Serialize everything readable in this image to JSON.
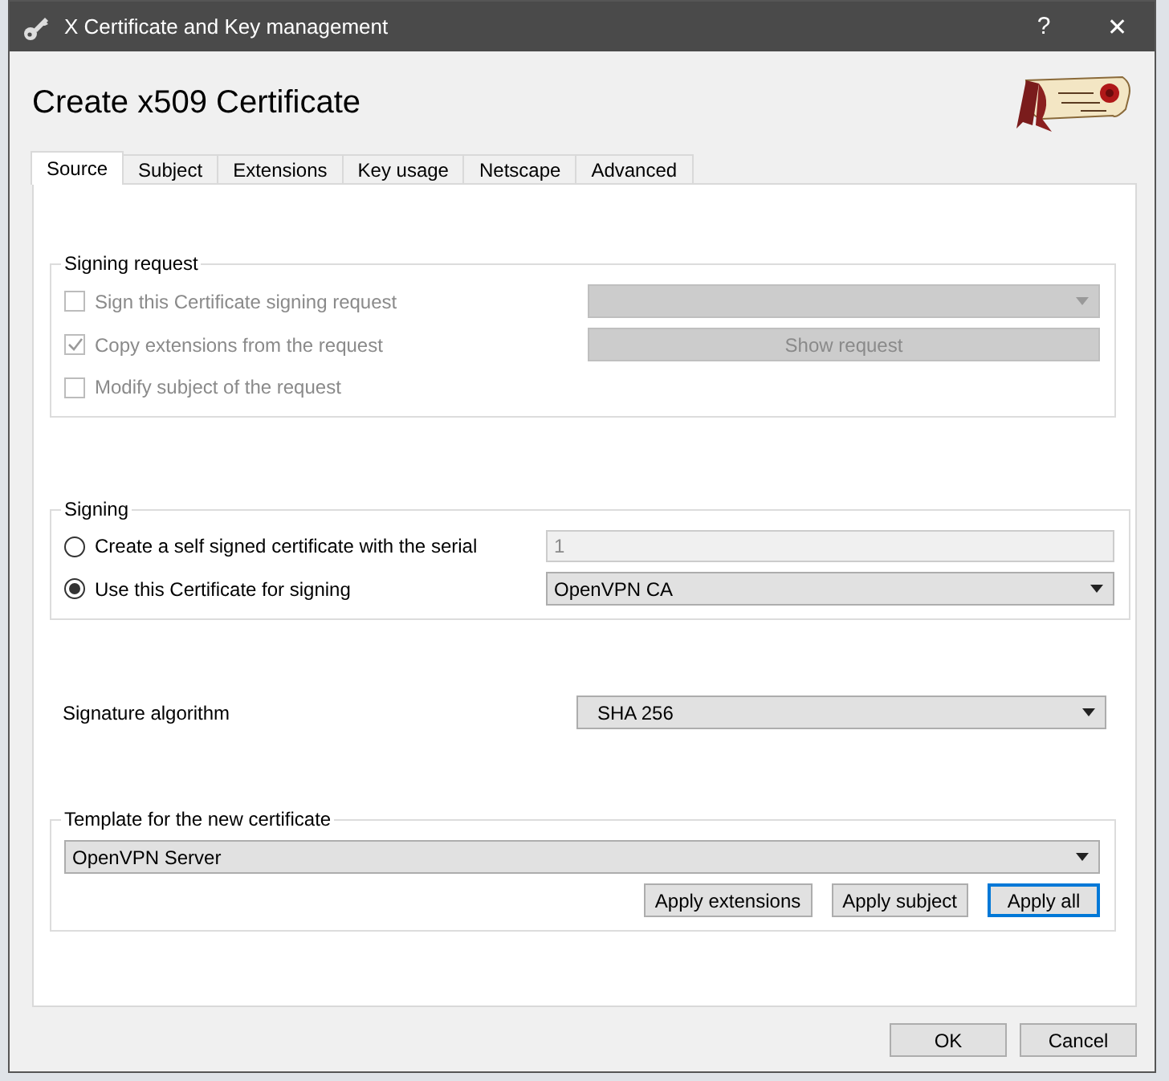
{
  "window": {
    "title": "X Certificate and Key management",
    "help": "?",
    "close": "✕"
  },
  "heading": "Create x509 Certificate",
  "tabs": [
    {
      "label": "Source",
      "selected": true
    },
    {
      "label": "Subject",
      "selected": false
    },
    {
      "label": "Extensions",
      "selected": false
    },
    {
      "label": "Key usage",
      "selected": false
    },
    {
      "label": "Netscape",
      "selected": false
    },
    {
      "label": "Advanced",
      "selected": false
    }
  ],
  "signing_request": {
    "title": "Signing request",
    "rows": [
      {
        "label": "Sign this Certificate signing request",
        "checked": false,
        "disabled": true,
        "control": {
          "kind": "combo",
          "disabled": true
        }
      },
      {
        "label": "Copy extensions from the request",
        "checked": true,
        "disabled": true,
        "control": {
          "kind": "button",
          "label": "Show request",
          "disabled": true
        }
      },
      {
        "label": "Modify subject of the request",
        "checked": false,
        "disabled": true
      }
    ]
  },
  "signing": {
    "title": "Signing",
    "options": [
      {
        "label": "Create a self signed certificate with the serial",
        "selected": false,
        "control": {
          "kind": "field",
          "value": "1",
          "disabled": true
        }
      },
      {
        "label": "Use this Certificate for signing",
        "selected": true,
        "control": {
          "kind": "combo",
          "value": "OpenVPN CA",
          "disabled": false
        }
      }
    ]
  },
  "signature_algorithm": {
    "label": "Signature algorithm",
    "value": "SHA 256"
  },
  "template": {
    "title": "Template for the new certificate",
    "value": "OpenVPN Server",
    "buttons": [
      {
        "label": "Apply extensions",
        "focused": false
      },
      {
        "label": "Apply subject",
        "focused": false
      },
      {
        "label": "Apply all",
        "focused": true
      }
    ]
  },
  "buttons": [
    "OK",
    "Cancel"
  ]
}
